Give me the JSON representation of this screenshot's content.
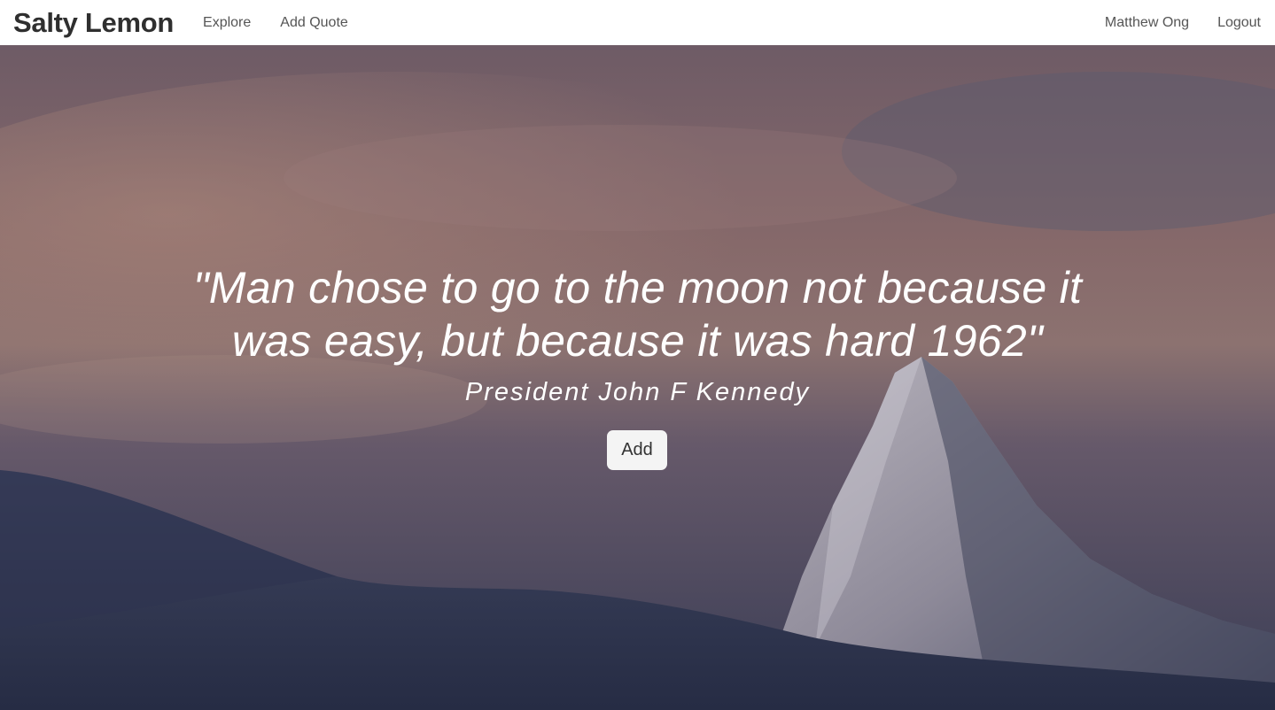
{
  "nav": {
    "brand": "Salty Lemon",
    "explore_label": "Explore",
    "add_quote_label": "Add Quote",
    "user_name": "Matthew Ong",
    "logout_label": "Logout"
  },
  "hero": {
    "quote_open": "\"",
    "quote_text": "Man chose to go to the moon not because it was easy, but because it was hard 1962",
    "quote_close": "\"",
    "author": "President John F Kennedy",
    "add_label": "Add"
  }
}
